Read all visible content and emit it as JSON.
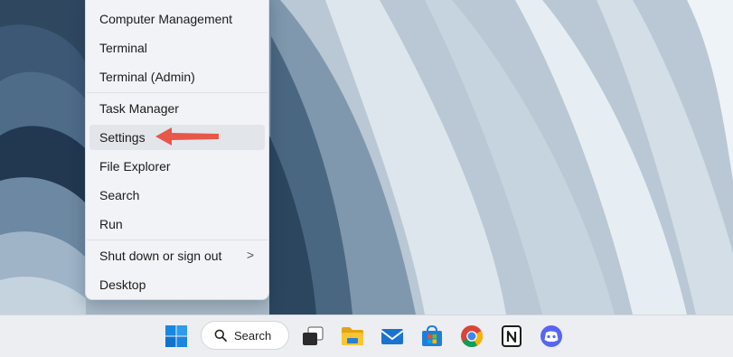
{
  "menu": {
    "items": [
      {
        "label": "Computer Management"
      },
      {
        "label": "Terminal"
      },
      {
        "label": "Terminal (Admin)"
      },
      {
        "label": "Task Manager"
      },
      {
        "label": "Settings"
      },
      {
        "label": "File Explorer"
      },
      {
        "label": "Search"
      },
      {
        "label": "Run"
      },
      {
        "label": "Shut down or sign out",
        "submenu_arrow": ">"
      },
      {
        "label": "Desktop"
      }
    ],
    "highlighted_item": "Settings"
  },
  "annotation": {
    "arrow_color": "#e8574a",
    "points_to": "Settings"
  },
  "taskbar": {
    "search_label": "Search",
    "icons": [
      "start-icon",
      "search-icon",
      "task-view-icon",
      "file-explorer-icon",
      "mail-icon",
      "microsoft-store-icon",
      "chrome-icon",
      "notion-icon",
      "discord-icon"
    ]
  },
  "colors": {
    "taskbar_bg": "#eceef1",
    "menu_bg": "#f1f3f6",
    "windows_blue": "#0f7bd9",
    "discord": "#5865f2"
  }
}
